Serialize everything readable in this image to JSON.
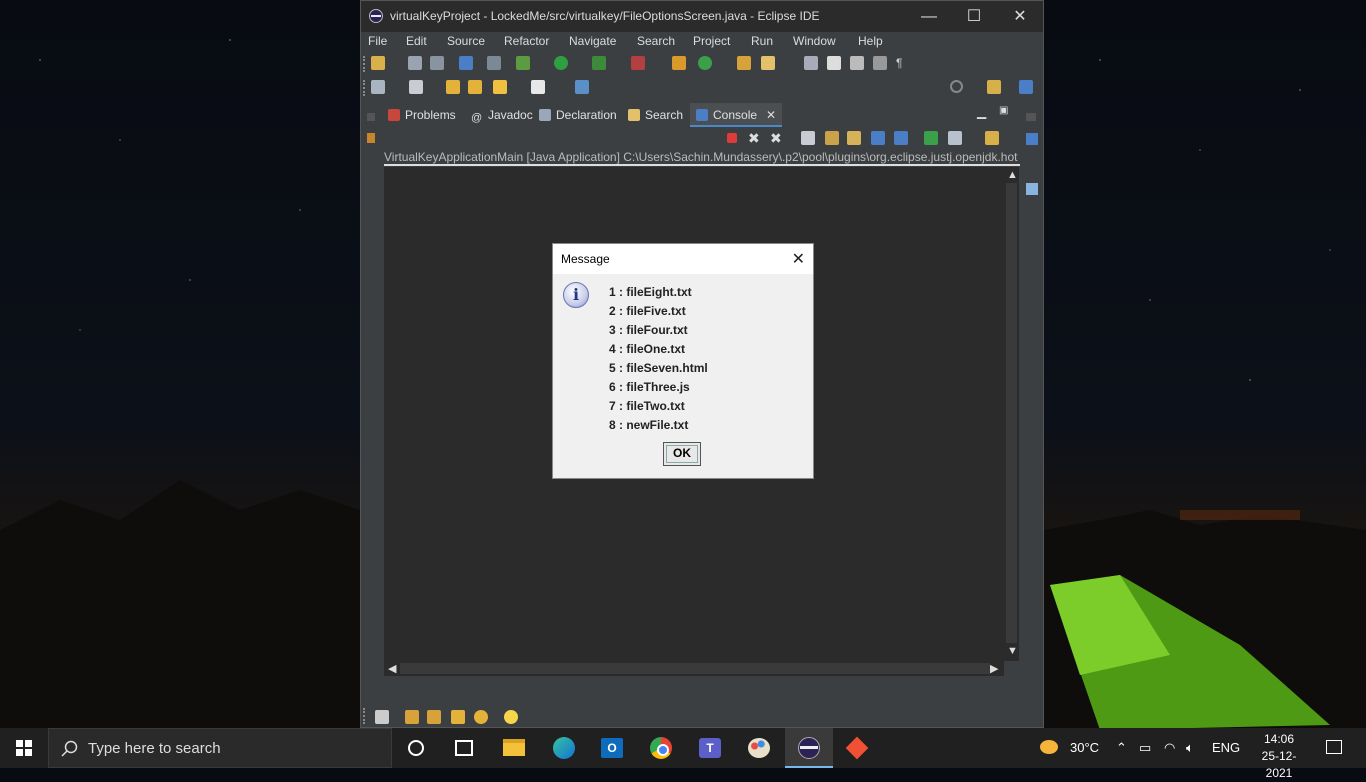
{
  "window": {
    "title": "virtualKeyProject - LockedMe/src/virtualkey/FileOptionsScreen.java - Eclipse IDE",
    "minimize": "—",
    "maximize": "☐",
    "close": "✕"
  },
  "menu": [
    "File",
    "Edit",
    "Source",
    "Refactor",
    "Navigate",
    "Search",
    "Project",
    "Run",
    "Window",
    "Help"
  ],
  "tabs": [
    {
      "label": "Problems",
      "icon": "problems-icon"
    },
    {
      "label": "Javadoc",
      "icon": "javadoc-icon"
    },
    {
      "label": "Declaration",
      "icon": "declaration-icon"
    },
    {
      "label": "Search",
      "icon": "search-icon"
    },
    {
      "label": "Console",
      "icon": "console-icon",
      "active": true
    }
  ],
  "console": {
    "launch_path": "VirtualKeyApplicationMain [Java Application] C:\\Users\\Sachin.Mundassery\\.p2\\pool\\plugins\\org.eclipse.justj.openjdk.hot"
  },
  "dialog": {
    "title": "Message",
    "close": "✕",
    "icon": "i",
    "files": [
      "1 : fileEight.txt",
      "2 : fileFive.txt",
      "3 : fileFour.txt",
      "4 : fileOne.txt",
      "5 : fileSeven.html",
      "6 : fileThree.js",
      "7 : fileTwo.txt",
      "8 : newFile.txt"
    ],
    "ok_label": "OK"
  },
  "taskbar": {
    "search_placeholder": "Type here to search",
    "temperature": "30°C",
    "language": "ENG",
    "time": "14:06",
    "date": "25-12-2021"
  },
  "colors": {
    "eclipse_dark": "#3c3f41",
    "console_bg": "#2b2b2b",
    "accent": "#4a88c7",
    "taskbar": "#202020"
  }
}
